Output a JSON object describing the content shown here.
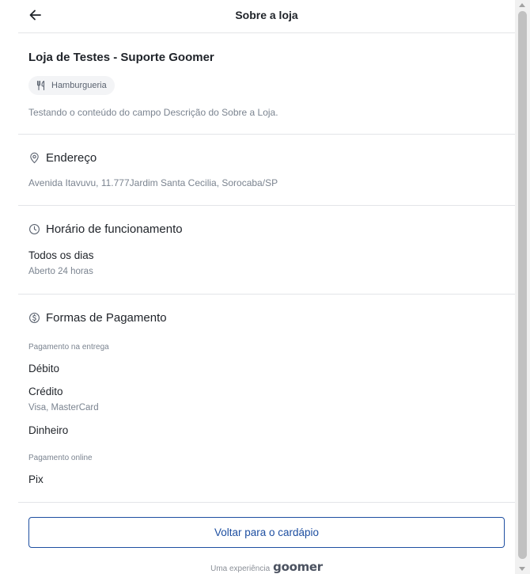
{
  "header": {
    "title": "Sobre a loja"
  },
  "store": {
    "name": "Loja de Testes - Suporte Goomer",
    "category": "Hamburgueria",
    "description": "Testando o conteúdo do campo Descrição do Sobre a Loja."
  },
  "address": {
    "heading": "Endereço",
    "text": "Avenida Itavuvu, 11.777Jardim Santa Cecilia, Sorocaba/SP"
  },
  "hours": {
    "heading": "Horário de funcionamento",
    "day": "Todos os dias",
    "time": "Aberto 24 horas"
  },
  "payments": {
    "heading": "Formas de Pagamento",
    "on_delivery_label": "Pagamento na entrega",
    "debit": "Débito",
    "credit": "Crédito",
    "credit_brands": "Visa, MasterCard",
    "cash": "Dinheiro",
    "online_label": "Pagamento online",
    "pix": "Pix"
  },
  "actions": {
    "back_to_menu": "Voltar para o cardápio"
  },
  "footer": {
    "text": "Uma experiência",
    "brand": "goomer"
  },
  "colors": {
    "accent": "#1e4fa1",
    "divider": "#e3e5e8",
    "muted_text": "#7b8490"
  }
}
